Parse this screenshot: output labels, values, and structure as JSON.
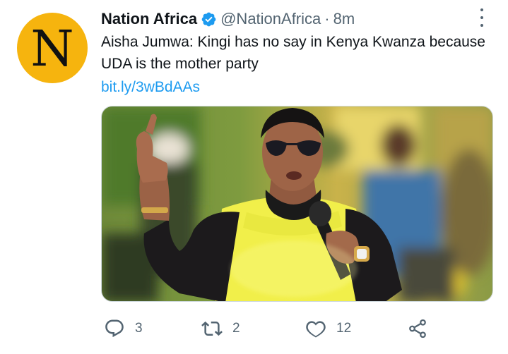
{
  "tweet": {
    "avatar_letter": "N",
    "display_name": "Nation Africa",
    "handle": "@NationAfrica",
    "separator": "·",
    "time": "8m",
    "text": "Aisha Jumwa: Kingi has no say in Kenya Kwanza because UDA is the mother party",
    "link": "bit.ly/3wBdAAs",
    "actions": {
      "reply_count": "3",
      "retweet_count": "2",
      "like_count": "12"
    }
  },
  "colors": {
    "avatar_bg": "#f6b40e",
    "accent": "#1d9bf0",
    "muted": "#536471"
  },
  "icons": [
    "verified-badge-icon",
    "more-options-icon",
    "reply-icon",
    "retweet-icon",
    "like-icon",
    "share-icon"
  ]
}
